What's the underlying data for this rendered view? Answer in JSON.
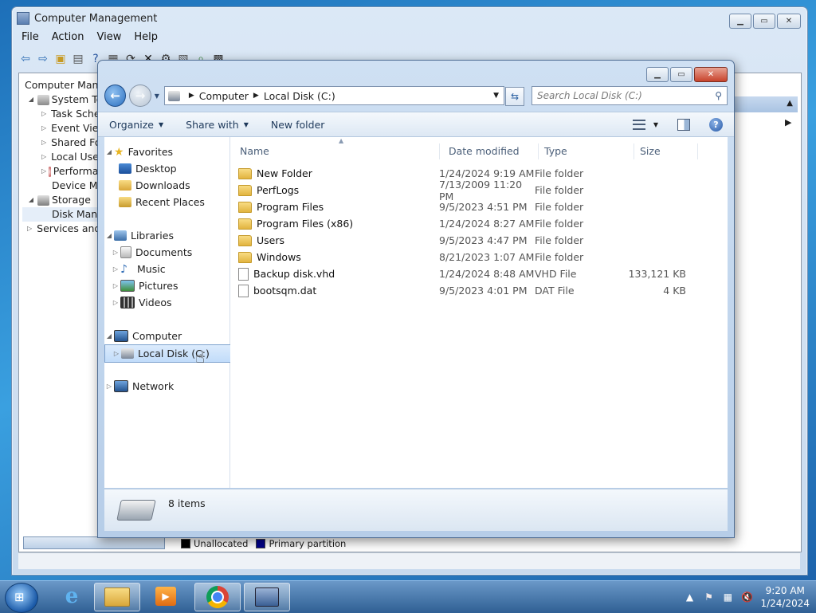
{
  "computer_management": {
    "title": "Computer Management",
    "menu": [
      "File",
      "Action",
      "View",
      "Help"
    ],
    "tree": [
      {
        "label": "Computer Management",
        "level": 0
      },
      {
        "label": "System Tools",
        "level": 1
      },
      {
        "label": "Task Scheduler",
        "level": 2
      },
      {
        "label": "Event Viewer",
        "level": 2
      },
      {
        "label": "Shared Folders",
        "level": 2
      },
      {
        "label": "Local Users and Groups",
        "level": 2
      },
      {
        "label": "Performance",
        "level": 2
      },
      {
        "label": "Device Manager",
        "level": 2
      },
      {
        "label": "Storage",
        "level": 1
      },
      {
        "label": "Disk Management",
        "level": 2
      },
      {
        "label": "Services and Applications",
        "level": 1
      }
    ],
    "legend": {
      "unallocated": "Unallocated",
      "primary": "Primary partition"
    },
    "colors": {
      "unallocated": "#000000",
      "primary": "#00008b"
    }
  },
  "explorer": {
    "breadcrumb": [
      "Computer",
      "Local Disk (C:)"
    ],
    "search_placeholder": "Search Local Disk (C:)",
    "toolbar": {
      "organize": "Organize",
      "share_with": "Share with",
      "new_folder": "New folder"
    },
    "nav": {
      "favorites": "Favorites",
      "favorites_items": [
        "Desktop",
        "Downloads",
        "Recent Places"
      ],
      "libraries": "Libraries",
      "libraries_items": [
        "Documents",
        "Music",
        "Pictures",
        "Videos"
      ],
      "computer": "Computer",
      "computer_items": [
        "Local Disk (C:)"
      ],
      "network": "Network"
    },
    "columns": {
      "name": "Name",
      "date": "Date modified",
      "type": "Type",
      "size": "Size"
    },
    "files": [
      {
        "name": "New Folder",
        "date": "1/24/2024 9:19 AM",
        "type": "File folder",
        "size": "",
        "kind": "folder"
      },
      {
        "name": "PerfLogs",
        "date": "7/13/2009 11:20 PM",
        "type": "File folder",
        "size": "",
        "kind": "folder"
      },
      {
        "name": "Program Files",
        "date": "9/5/2023 4:51 PM",
        "type": "File folder",
        "size": "",
        "kind": "folder"
      },
      {
        "name": "Program Files (x86)",
        "date": "1/24/2024 8:27 AM",
        "type": "File folder",
        "size": "",
        "kind": "folder"
      },
      {
        "name": "Users",
        "date": "9/5/2023 4:47 PM",
        "type": "File folder",
        "size": "",
        "kind": "folder"
      },
      {
        "name": "Windows",
        "date": "8/21/2023 1:07 AM",
        "type": "File folder",
        "size": "",
        "kind": "folder"
      },
      {
        "name": "Backup disk.vhd",
        "date": "1/24/2024 8:48 AM",
        "type": "VHD File",
        "size": "133,121 KB",
        "kind": "file"
      },
      {
        "name": "bootsqm.dat",
        "date": "9/5/2023 4:01 PM",
        "type": "DAT File",
        "size": "4 KB",
        "kind": "file"
      }
    ],
    "item_count": "8 items"
  },
  "taskbar": {
    "time": "9:20 AM",
    "date": "1/24/2024",
    "pinned": [
      "start-button",
      "internet-explorer-icon",
      "file-explorer-icon",
      "media-player-icon",
      "chrome-icon",
      "computer-management-icon"
    ]
  }
}
